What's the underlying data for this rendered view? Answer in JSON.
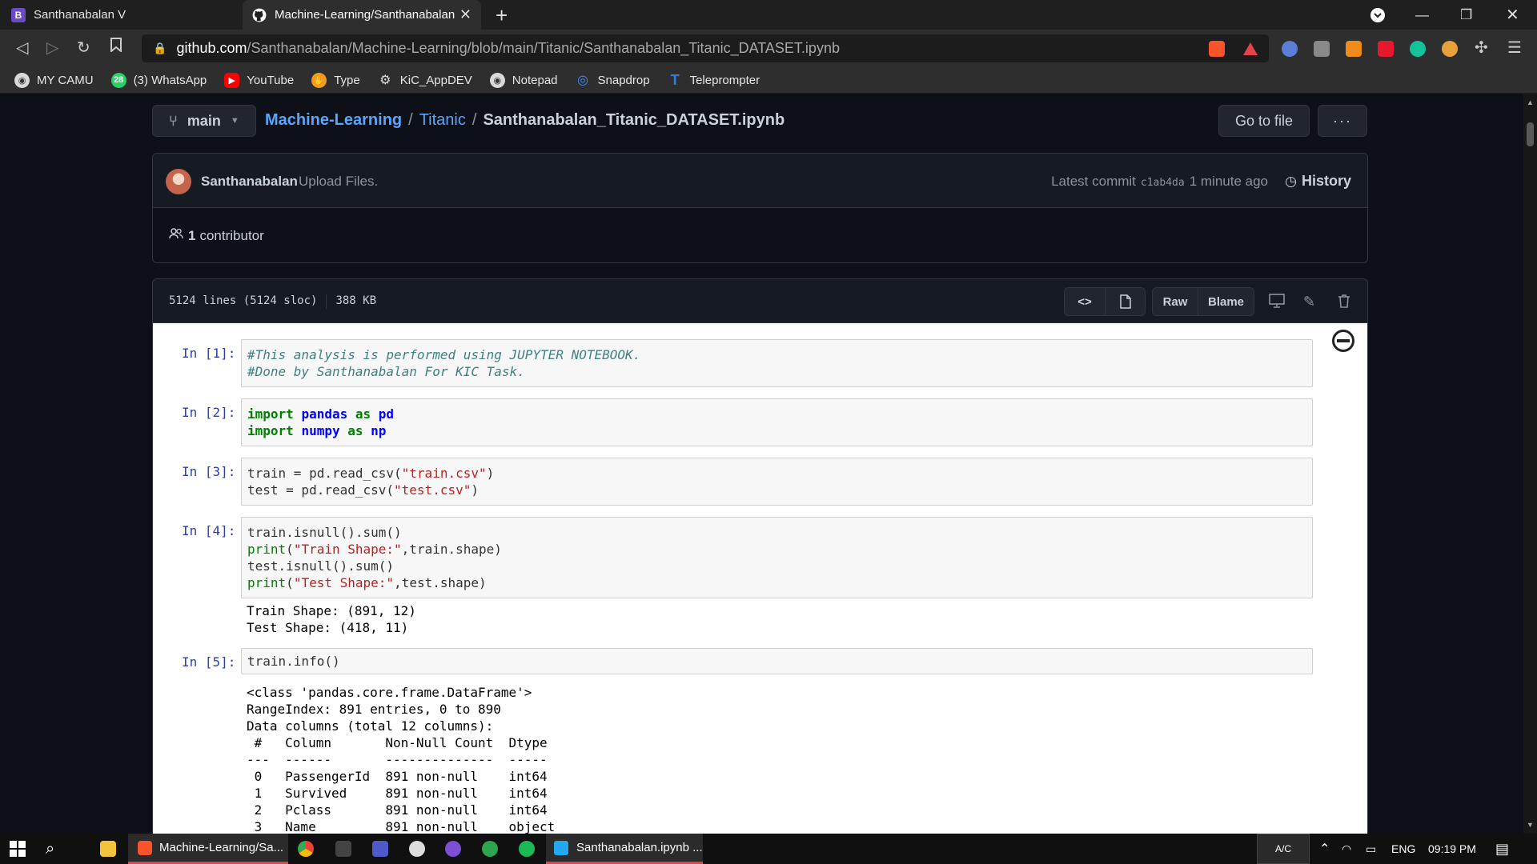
{
  "browser": {
    "tabs": [
      {
        "label": "Santhanabalan V",
        "favicon": "B"
      },
      {
        "label": "Machine-Learning/Santhanabalan",
        "favicon": "github-icon"
      }
    ],
    "url_host": "github.com",
    "url_path": "/Santhanabalan/Machine-Learning/blob/main/Titanic/Santhanabalan_Titanic_DATASET.ipynb",
    "shield_badge": "7",
    "bookmarks": [
      {
        "label": "MY CAMU",
        "color": "#d9d9d9"
      },
      {
        "label": "(3) WhatsApp",
        "color": "#25d366",
        "badge": "28"
      },
      {
        "label": "YouTube",
        "color": "#ff0000"
      },
      {
        "label": "Type",
        "color": "#f29c1f"
      },
      {
        "label": "KiC_AppDEV",
        "color": "#d9d9d9"
      },
      {
        "label": "Notepad",
        "color": "#d9d9d9"
      },
      {
        "label": "Snapdrop",
        "color": "#4a8cff"
      },
      {
        "label": "Teleprompter",
        "color": "#3a7bd5"
      }
    ]
  },
  "repo": {
    "branch": "main",
    "crumbs": [
      "Machine-Learning",
      "Titanic"
    ],
    "file_name": "Santhanabalan_Titanic_DATASET.ipynb",
    "goto_label": "Go to file",
    "more_label": "···"
  },
  "commit": {
    "author": "Santhanabalan",
    "message": "Upload Files.",
    "latest_label": "Latest commit",
    "sha": "c1ab4da",
    "time": "1 minute ago",
    "history_label": "History",
    "contributors_count": "1",
    "contributors_label": "contributor"
  },
  "file": {
    "lines": "5124 lines (5124 sloc)",
    "size": "388 KB",
    "raw_label": "Raw",
    "blame_label": "Blame"
  },
  "notebook": {
    "cells": [
      {
        "prompt": "In [1]:",
        "lines": [
          "#This analysis is performed using JUPYTER NOTEBOOK.",
          "#Done by Santhanabalan For KIC Task."
        ]
      },
      {
        "prompt": "In [2]:",
        "lines": [
          "import pandas as pd",
          "import numpy as np"
        ]
      },
      {
        "prompt": "In [3]:",
        "lines": [
          "train = pd.read_csv(\"train.csv\")",
          "test = pd.read_csv(\"test.csv\")"
        ]
      },
      {
        "prompt": "In [4]:",
        "lines": [
          "train.isnull().sum()",
          "print(\"Train Shape:\",train.shape)",
          "test.isnull().sum()",
          "print(\"Test Shape:\",test.shape)"
        ],
        "output": [
          "Train Shape: (891, 12)",
          "Test Shape: (418, 11)"
        ]
      },
      {
        "prompt": "In [5]:",
        "lines": [
          "train.info()"
        ],
        "output": [
          "<class 'pandas.core.frame.DataFrame'>",
          "RangeIndex: 891 entries, 0 to 890",
          "Data columns (total 12 columns):",
          " #   Column       Non-Null Count  Dtype ",
          "---  ------       --------------  ----- ",
          " 0   PassengerId  891 non-null    int64 ",
          " 1   Survived     891 non-null    int64 ",
          " 2   Pclass       891 non-null    int64 ",
          " 3   Name         891 non-null    object"
        ]
      }
    ]
  },
  "taskbar": {
    "browser_item": "Machine-Learning/Sa...",
    "vscode_item": "Santhanabalan.ipynb ...",
    "ac_label": "A/C",
    "lang": "ENG",
    "clock": "09:19 PM"
  }
}
